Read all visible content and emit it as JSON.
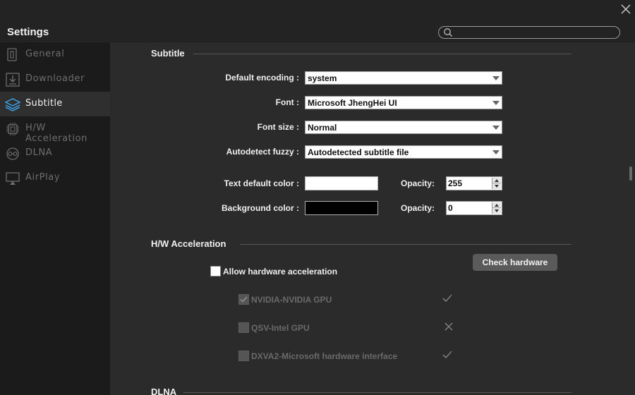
{
  "window": {
    "title": "Settings",
    "close_icon": "close-icon"
  },
  "search": {
    "placeholder": "",
    "value": "",
    "icon": "search-icon"
  },
  "sidebar": {
    "items": [
      {
        "label": "General",
        "icon": "general-icon",
        "active": false
      },
      {
        "label": "Downloader",
        "icon": "downloader-icon",
        "active": false
      },
      {
        "label": "Subtitle",
        "icon": "layers-icon",
        "active": true
      },
      {
        "label": "H/W Acceleration",
        "icon": "chip-icon",
        "active": false
      },
      {
        "label": "DLNA",
        "icon": "dlna-icon",
        "active": false
      },
      {
        "label": "AirPlay",
        "icon": "airplay-icon",
        "active": false
      }
    ]
  },
  "subtitle": {
    "title": "Subtitle",
    "default_encoding": {
      "label": "Default encoding :",
      "value": "system"
    },
    "font": {
      "label": "Font :",
      "value": "Microsoft JhengHei UI"
    },
    "font_size": {
      "label": "Font size :",
      "value": "Normal"
    },
    "autodetect": {
      "label": "Autodetect fuzzy :",
      "value": "Autodetected subtitle file"
    },
    "text_color": {
      "label": "Text default color :",
      "color": "#ffffff",
      "opacity_label": "Opacity:",
      "opacity": "255"
    },
    "bg_color": {
      "label": "Background color :",
      "color": "#000000",
      "opacity_label": "Opacity:",
      "opacity": "0"
    }
  },
  "hw": {
    "title": "H/W Acceleration",
    "check_button": "Check hardware",
    "allow_label": "Allow hardware acceleration",
    "allow_checked": false,
    "devices": [
      {
        "label": "NVIDIA-NVIDIA GPU",
        "checked": true,
        "status": "check-icon"
      },
      {
        "label": "QSV-Intel GPU",
        "checked": false,
        "status": "cross-icon"
      },
      {
        "label": "DXVA2-Microsoft hardware interface",
        "checked": false,
        "status": "check-icon"
      }
    ]
  },
  "dlna": {
    "title": "DLNA"
  },
  "colors": {
    "accent": "#3fa9f5",
    "panel": "#2b2b2b",
    "sidebar": "#1b1b1b",
    "button": "#5a5a5a"
  }
}
